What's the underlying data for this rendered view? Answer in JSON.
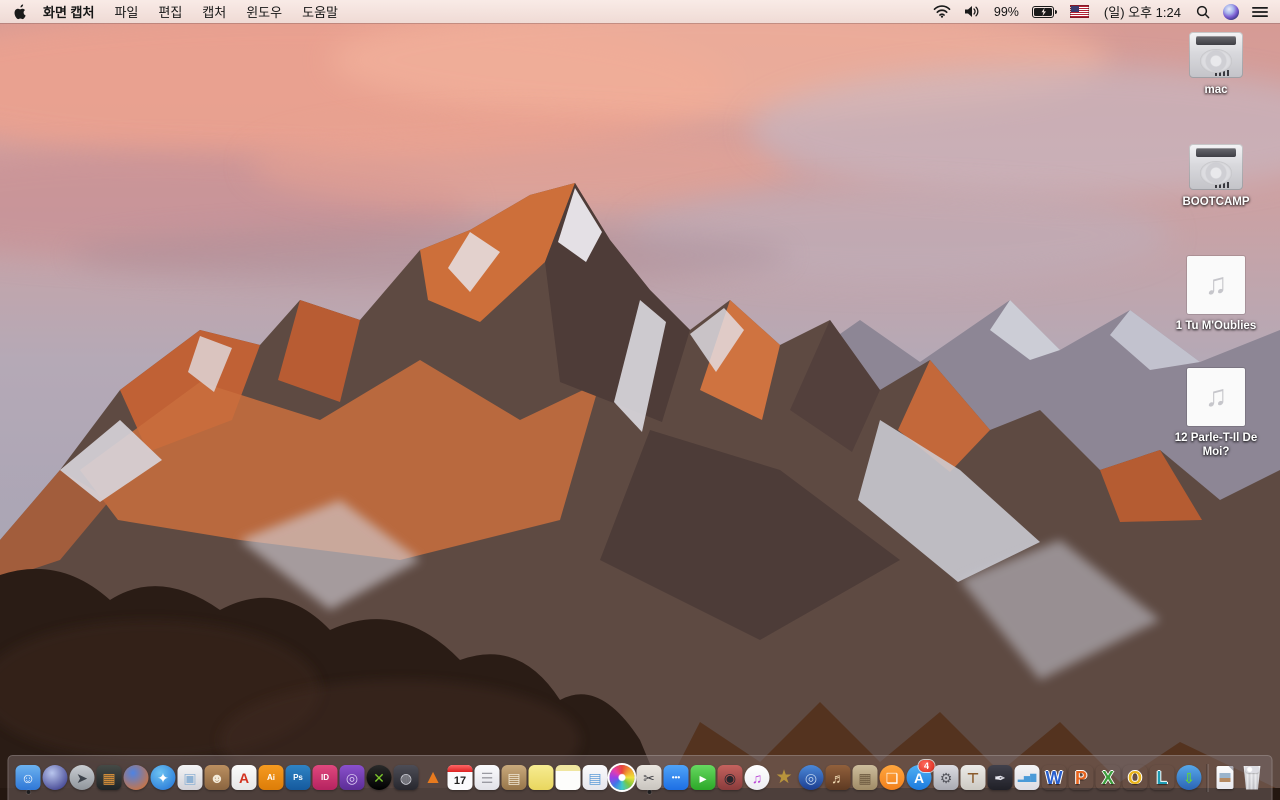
{
  "menu_bar": {
    "app_name": "화면 캡처",
    "menus": [
      "파일",
      "편집",
      "캡처",
      "윈도우",
      "도움말"
    ],
    "status": {
      "battery_percent": "99%",
      "battery_state": "charging",
      "clock": "(일) 오후 1:24",
      "input_source": "U.S. flag"
    }
  },
  "desktop": {
    "icons": [
      {
        "label": "mac",
        "type": "hard-drive"
      },
      {
        "label": "BOOTCAMP",
        "type": "hard-drive"
      },
      {
        "label": "1 Tu M'Oublies",
        "type": "audio-file"
      },
      {
        "label": "12 Parle-T-Il De Moi?",
        "type": "audio-file"
      }
    ]
  },
  "dock": {
    "items": [
      {
        "name": "finder",
        "glyph": "☺",
        "fg": "#ffffff",
        "c1": "#6cb2f0",
        "c2": "#2f77d6",
        "shape": "r",
        "running": true
      },
      {
        "name": "siri",
        "glyph": "",
        "c1": "#b9c6ee",
        "c2": "#2a2a7e",
        "shape": "c",
        "style": "radial"
      },
      {
        "name": "launchpad",
        "glyph": "➤",
        "fg": "#3d434b",
        "c1": "#c9cdd2",
        "c2": "#8f959b",
        "shape": "c"
      },
      {
        "name": "mission-control",
        "glyph": "▦",
        "fg": "#e89a3c",
        "c1": "#454a46",
        "c2": "#1f2426",
        "shape": "r"
      },
      {
        "name": "firefox",
        "glyph": "",
        "c1": "#4d83e4",
        "c2": "#e8701c",
        "shape": "c",
        "style": "radial"
      },
      {
        "name": "safari",
        "glyph": "✦",
        "fg": "#ffffff",
        "c1": "#6cc2f2",
        "c2": "#1f6fd4",
        "shape": "c",
        "style": "radial"
      },
      {
        "name": "preview",
        "glyph": "▣",
        "fg": "#8fb2d4",
        "c1": "#f4f4f6",
        "c2": "#d2d2d8",
        "shape": "r"
      },
      {
        "name": "contacts",
        "glyph": "☻",
        "fg": "#f3ead8",
        "c1": "#bb8f60",
        "c2": "#8a6540",
        "shape": "r"
      },
      {
        "name": "adobe-acrobat",
        "glyph": "A",
        "fg": "#d3321f",
        "c1": "#fbfbfb",
        "c2": "#e6e6e6",
        "shape": "r"
      },
      {
        "name": "adobe-illustrator",
        "glyph": "Ai",
        "fg": "#ffffff",
        "c1": "#f59a20",
        "c2": "#dd7d08",
        "shape": "r"
      },
      {
        "name": "adobe-photoshop",
        "glyph": "Ps",
        "fg": "#ffffff",
        "c1": "#2f83c4",
        "c2": "#155a9e",
        "shape": "r"
      },
      {
        "name": "adobe-indesign",
        "glyph": "ID",
        "fg": "#ffffff",
        "c1": "#e0487e",
        "c2": "#b52360",
        "shape": "r"
      },
      {
        "name": "toast-titanium",
        "glyph": "◎",
        "fg": "#d9c8f2",
        "c1": "#8a50cc",
        "c2": "#5c2d96",
        "shape": "r"
      },
      {
        "name": "green-x-app",
        "glyph": "✕",
        "fg": "#7cc62c",
        "c1": "#2a2a2a",
        "c2": "#000000",
        "shape": "c"
      },
      {
        "name": "dark-disc-app",
        "glyph": "◍",
        "fg": "#cfd0d8",
        "c1": "#4d4d56",
        "c2": "#27272e",
        "shape": "r"
      },
      {
        "name": "vlc",
        "glyph": "▲",
        "fg": "#e87a1e",
        "shape": "n"
      },
      {
        "name": "calendar",
        "glyph": "17",
        "kind": "calendar"
      },
      {
        "name": "reminders",
        "glyph": "☰",
        "fg": "#9a9aa2",
        "c1": "#fbfbfd",
        "c2": "#e2e2e8",
        "shape": "r"
      },
      {
        "name": "stuffit-expander",
        "glyph": "▤",
        "fg": "#efe6d2",
        "c1": "#c9a97c",
        "c2": "#97764a",
        "shape": "r"
      },
      {
        "name": "stickies",
        "glyph": "",
        "c1": "#f7ec92",
        "c2": "#e9d65e",
        "shape": "r"
      },
      {
        "name": "notes",
        "glyph": "",
        "kind": "notes"
      },
      {
        "name": "document-app",
        "glyph": "▤",
        "fg": "#5d9bd8",
        "c1": "#fafafc",
        "c2": "#e6e6ec",
        "shape": "r"
      },
      {
        "name": "photos",
        "glyph": "",
        "kind": "photos"
      },
      {
        "name": "grab-screen-capture",
        "glyph": "✂",
        "fg": "#3f3f44",
        "c1": "#ece8e2",
        "c2": "#c9c5bf",
        "shape": "r",
        "running": true
      },
      {
        "name": "messages",
        "glyph": "•••",
        "fg": "#ffffff",
        "c1": "#4fa3f8",
        "c2": "#1d6fe4",
        "shape": "r"
      },
      {
        "name": "facetime",
        "glyph": "▸",
        "fg": "#ffffff",
        "c1": "#66d860",
        "c2": "#2ca828",
        "shape": "r"
      },
      {
        "name": "photo-booth",
        "glyph": "◉",
        "fg": "#26262c",
        "c1": "#c4625e",
        "c2": "#8a3c3c",
        "shape": "r"
      },
      {
        "name": "itunes",
        "glyph": "♫",
        "fg": "#b944d6",
        "c1": "#ffffff",
        "c2": "#ececf2",
        "shape": "c"
      },
      {
        "name": "imovie",
        "glyph": "★",
        "fg": "#b8943c",
        "shape": "n"
      },
      {
        "name": "idvd",
        "glyph": "◎",
        "fg": "#bcd2ee",
        "c1": "#4b88d8",
        "c2": "#1c3e90",
        "shape": "c"
      },
      {
        "name": "garageband",
        "glyph": "♬",
        "fg": "#f2dcb4",
        "c1": "#91603c",
        "c2": "#5e3a22",
        "shape": "r"
      },
      {
        "name": "scrapbook-app",
        "glyph": "▦",
        "fg": "#6d5a40",
        "c1": "#cdbd9c",
        "c2": "#a08b66",
        "shape": "r"
      },
      {
        "name": "ibooks",
        "glyph": "❏",
        "fg": "#ffffff",
        "c1": "#ffa63e",
        "c2": "#f2801c",
        "shape": "c"
      },
      {
        "name": "app-store",
        "glyph": "A",
        "fg": "#ffffff",
        "c1": "#4fb0f4",
        "c2": "#1c7ade",
        "shape": "c",
        "badge": "4"
      },
      {
        "name": "system-preferences",
        "glyph": "⚙",
        "fg": "#55565e",
        "c1": "#dcdce2",
        "c2": "#a9aab2",
        "shape": "r"
      },
      {
        "name": "keynote",
        "glyph": "⊤",
        "fg": "#8a5a2c",
        "c1": "#ecebe8",
        "c2": "#ccc9c2",
        "shape": "r"
      },
      {
        "name": "pages",
        "glyph": "✒",
        "fg": "#e9e9f2",
        "c1": "#41414c",
        "c2": "#202027",
        "shape": "r"
      },
      {
        "name": "numbers",
        "glyph": "▂▅▇",
        "fg": "#4a9ad8",
        "c1": "#f4f4f6",
        "c2": "#dddde4",
        "shape": "r"
      },
      {
        "name": "ms-word",
        "glyph": "W",
        "fg": "#2a60ce",
        "kind": "letter"
      },
      {
        "name": "ms-powerpoint",
        "glyph": "P",
        "fg": "#e8641e",
        "kind": "letter"
      },
      {
        "name": "ms-excel",
        "glyph": "X",
        "fg": "#3c9e3c",
        "kind": "letter"
      },
      {
        "name": "ms-outlook",
        "glyph": "O",
        "fg": "#e9b41c",
        "kind": "letter"
      },
      {
        "name": "ms-lync",
        "glyph": "L",
        "fg": "#1e9cb4",
        "kind": "letter"
      },
      {
        "name": "microsoft-update",
        "glyph": "⇩",
        "fg": "#62d63a",
        "c1": "#57a8ea",
        "c2": "#2a64b4",
        "shape": "c"
      },
      {
        "name": "separator",
        "kind": "sep"
      },
      {
        "name": "screenshot-image-file",
        "kind": "file"
      },
      {
        "name": "trash",
        "kind": "trash",
        "state": "full"
      }
    ]
  },
  "wallpaper": {
    "name": "macOS Sierra mountain (Lone Pine Peak at sunset)",
    "sky_top": "#d89a93",
    "sky_mid": "#b5a9b6",
    "cloud_pink": "#eda28f",
    "rock_sunlit": "#c96e3d",
    "rock_shadow": "#4e3c38",
    "snow": "#e3e1e8",
    "foreground_rock": "#2a1c15"
  }
}
